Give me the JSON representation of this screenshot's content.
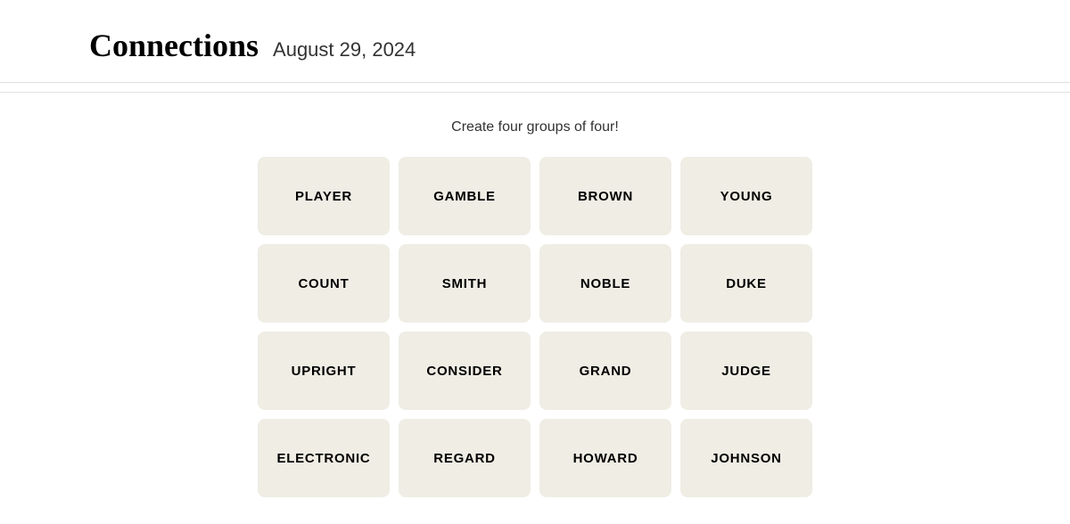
{
  "header": {
    "title": "Connections",
    "date": "August 29, 2024"
  },
  "game": {
    "instructions": "Create four groups of four!",
    "tiles": [
      {
        "id": "tile-1",
        "label": "PLAYER"
      },
      {
        "id": "tile-2",
        "label": "GAMBLE"
      },
      {
        "id": "tile-3",
        "label": "BROWN"
      },
      {
        "id": "tile-4",
        "label": "YOUNG"
      },
      {
        "id": "tile-5",
        "label": "COUNT"
      },
      {
        "id": "tile-6",
        "label": "SMITH"
      },
      {
        "id": "tile-7",
        "label": "NOBLE"
      },
      {
        "id": "tile-8",
        "label": "DUKE"
      },
      {
        "id": "tile-9",
        "label": "UPRIGHT"
      },
      {
        "id": "tile-10",
        "label": "CONSIDER"
      },
      {
        "id": "tile-11",
        "label": "GRAND"
      },
      {
        "id": "tile-12",
        "label": "JUDGE"
      },
      {
        "id": "tile-13",
        "label": "ELECTRONIC"
      },
      {
        "id": "tile-14",
        "label": "REGARD"
      },
      {
        "id": "tile-15",
        "label": "HOWARD"
      },
      {
        "id": "tile-16",
        "label": "JOHNSON"
      }
    ]
  }
}
